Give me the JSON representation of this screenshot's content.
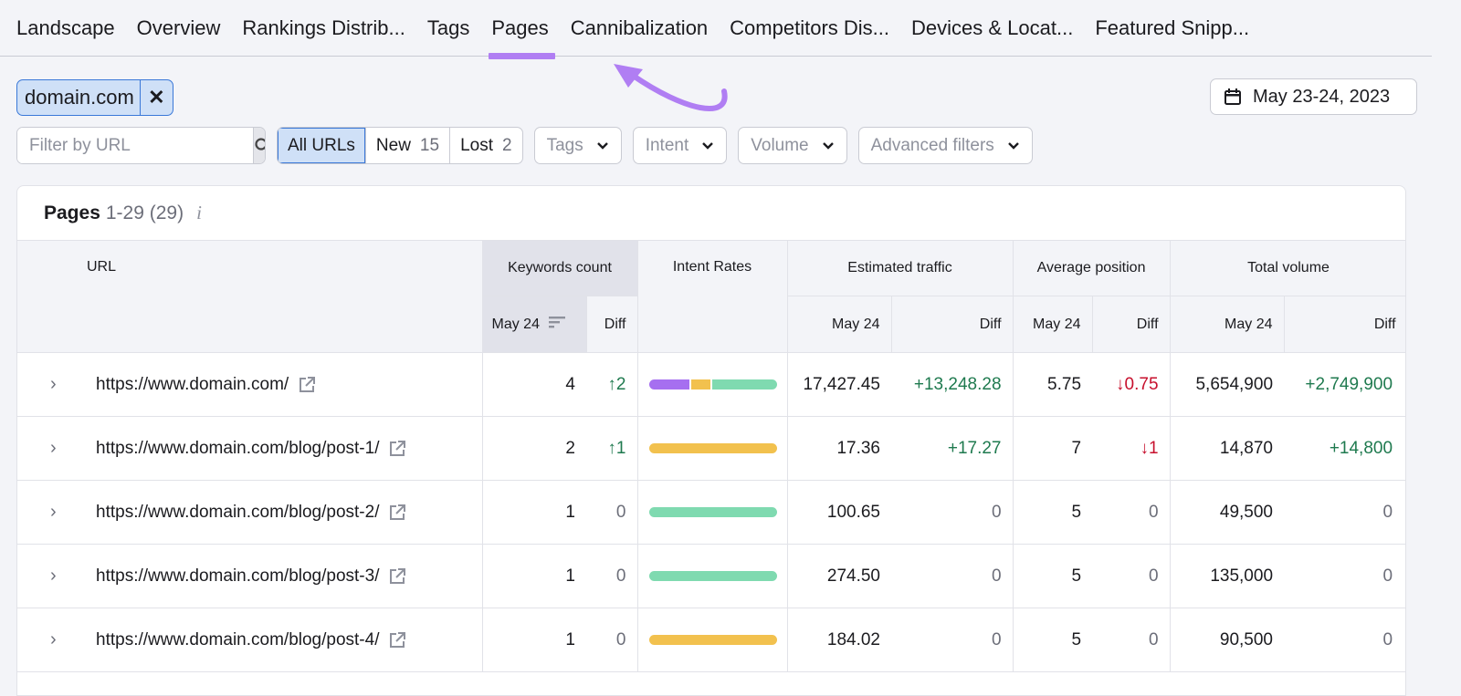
{
  "tabs": [
    "Landscape",
    "Overview",
    "Rankings Distrib...",
    "Tags",
    "Pages",
    "Cannibalization",
    "Competitors Dis...",
    "Devices & Locat...",
    "Featured Snipp..."
  ],
  "active_tab": "Pages",
  "domain_chip": {
    "label": "domain.com",
    "remove": "✕"
  },
  "date_range": "May 23-24, 2023",
  "filters": {
    "url_placeholder": "Filter by URL",
    "all": "All URLs",
    "new": "New",
    "new_count": "15",
    "lost": "Lost",
    "lost_count": "2",
    "tags": "Tags",
    "intent": "Intent",
    "volume": "Volume",
    "advanced": "Advanced filters"
  },
  "card": {
    "title": "Pages",
    "range": "1-29 (29)",
    "info": "i"
  },
  "columns": {
    "url": "URL",
    "keywords": "Keywords count",
    "intent": "Intent Rates",
    "traffic": "Estimated traffic",
    "position": "Average position",
    "volume": "Total volume",
    "date": "May 24",
    "diff": "Diff"
  },
  "colors": {
    "commercial": "#a66ff0",
    "navigational": "#f2c14e",
    "informational": "#7fdab0",
    "accent": "#b07ef3"
  },
  "rows": [
    {
      "url": "https://www.domain.com/",
      "kw": "4",
      "kw_diff": "↑2",
      "kw_dir": "up",
      "intent": [
        0.33,
        0.15,
        0.52
      ],
      "traffic": "17,427.45",
      "traffic_diff": "+13,248.28",
      "traffic_dir": "up",
      "pos": "5.75",
      "pos_diff": "↓0.75",
      "pos_dir": "down",
      "vol": "5,654,900",
      "vol_diff": "+2,749,900",
      "vol_dir": "up"
    },
    {
      "url": "https://www.domain.com/blog/post-1/",
      "kw": "2",
      "kw_diff": "↑1",
      "kw_dir": "up",
      "intent": [
        0,
        1,
        0
      ],
      "traffic": "17.36",
      "traffic_diff": "+17.27",
      "traffic_dir": "up",
      "pos": "7",
      "pos_diff": "↓1",
      "pos_dir": "down",
      "vol": "14,870",
      "vol_diff": "+14,800",
      "vol_dir": "up"
    },
    {
      "url": "https://www.domain.com/blog/post-2/",
      "kw": "1",
      "kw_diff": "0",
      "kw_dir": "zero",
      "intent": [
        0,
        0,
        1
      ],
      "traffic": "100.65",
      "traffic_diff": "0",
      "traffic_dir": "zero",
      "pos": "5",
      "pos_diff": "0",
      "pos_dir": "zero",
      "vol": "49,500",
      "vol_diff": "0",
      "vol_dir": "zero"
    },
    {
      "url": "https://www.domain.com/blog/post-3/",
      "kw": "1",
      "kw_diff": "0",
      "kw_dir": "zero",
      "intent": [
        0,
        0,
        1
      ],
      "traffic": "274.50",
      "traffic_diff": "0",
      "traffic_dir": "zero",
      "pos": "5",
      "pos_diff": "0",
      "pos_dir": "zero",
      "vol": "135,000",
      "vol_diff": "0",
      "vol_dir": "zero"
    },
    {
      "url": "https://www.domain.com/blog/post-4/",
      "kw": "1",
      "kw_diff": "0",
      "kw_dir": "zero",
      "intent": [
        0,
        1,
        0
      ],
      "traffic": "184.02",
      "traffic_diff": "0",
      "traffic_dir": "zero",
      "pos": "5",
      "pos_diff": "0",
      "pos_dir": "zero",
      "vol": "90,500",
      "vol_diff": "0",
      "vol_dir": "zero"
    }
  ]
}
